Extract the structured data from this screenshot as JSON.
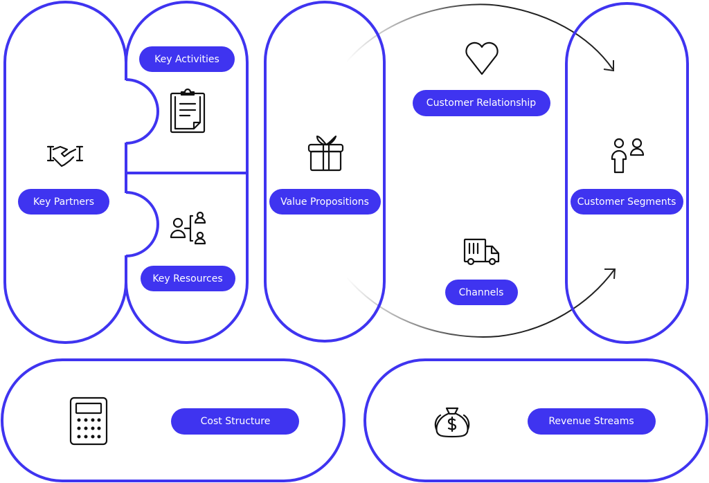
{
  "colors": {
    "accent": "#3f34f0",
    "arrow": "#222222"
  },
  "blocks": {
    "key_partners": {
      "label": "Key Partners",
      "icon": "handshake-icon"
    },
    "key_activities": {
      "label": "Key Activities",
      "icon": "clipboard-icon"
    },
    "key_resources": {
      "label": "Key Resources",
      "icon": "people-network-icon"
    },
    "value_propositions": {
      "label": "Value Propositions",
      "icon": "gift-icon"
    },
    "customer_relationship": {
      "label": "Customer Relationship",
      "icon": "heart-icon"
    },
    "channels": {
      "label": "Channels",
      "icon": "truck-icon"
    },
    "customer_segments": {
      "label": "Customer Segments",
      "icon": "users-icon"
    },
    "cost_structure": {
      "label": "Cost Structure",
      "icon": "calculator-icon"
    },
    "revenue_streams": {
      "label": "Revenue Streams",
      "icon": "money-bag-icon"
    }
  }
}
